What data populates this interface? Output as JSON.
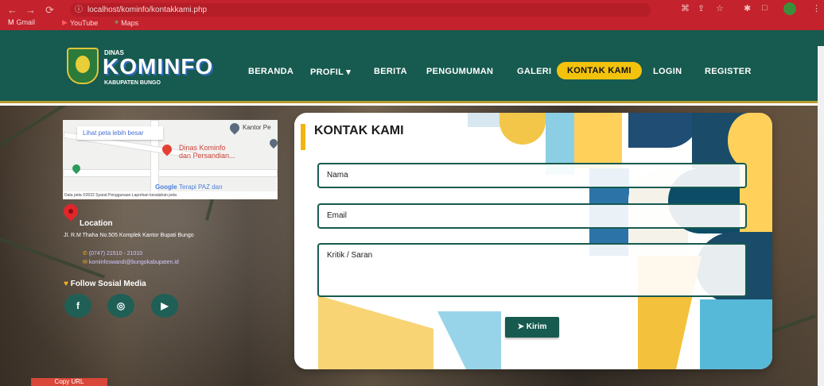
{
  "browser": {
    "url": "localhost/kominfo/kontakkami.php",
    "bookmarks": [
      "Gmail",
      "YouTube",
      "Maps"
    ]
  },
  "brand": {
    "small": "DINAS",
    "name": "KOMINFO",
    "sub": "KABUPATEN BUNGO"
  },
  "nav": {
    "items": [
      "BERANDA",
      "PROFIL ▾",
      "BERITA",
      "PENGUMUMAN",
      "GALERI",
      "KONTAK KAMI",
      "LOGIN",
      "REGISTER"
    ]
  },
  "map": {
    "link": "Lihat peta lebih besar",
    "place": "Dinas Kominfo\ndan Persandian...",
    "kantor": "Kantor Pe",
    "terapi": "Terapi PAZ dan",
    "google": "Google",
    "footer": "Data peta ©2022  Syarat Penggunaan  Laporkan kesalahan peta"
  },
  "contact": {
    "location_title": "Location",
    "address": "Jl. R.M Thaha No.505 Komplek Kantor Bupati Bungo",
    "phone": "(0747) 21510 - 21010",
    "email": "kominfoswandi@bungokabupaten.id",
    "follow": "Follow Sosial Media"
  },
  "form": {
    "title": "KONTAK KAMI",
    "name_label": "Nama",
    "email_label": "Email",
    "message_label": "Kritik / Saran",
    "submit_label": "Kirim"
  },
  "footer": {
    "copy_label": "Copy URL"
  }
}
